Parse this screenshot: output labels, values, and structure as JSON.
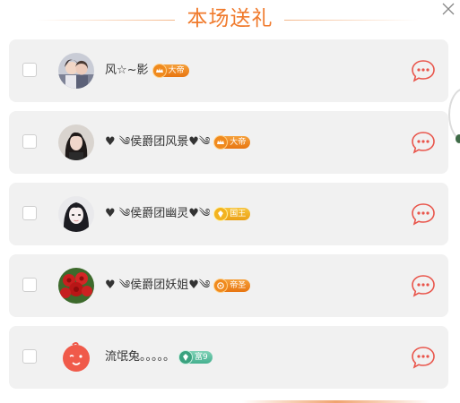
{
  "header": {
    "title": "本场送礼"
  },
  "colors": {
    "accent": "#f07a2c",
    "chat_icon": "#e9544a",
    "card_bg": "#f1f1f1"
  },
  "users": [
    {
      "name": "风☆~影",
      "badge": "大帝",
      "badge_style": "orange",
      "avatar": "couple-photo"
    },
    {
      "name": "♥ ༄侯爵团风景♥༄",
      "badge": "大帝",
      "badge_style": "orange",
      "avatar": "woman-dark-hair"
    },
    {
      "name": "♥ ༄侯爵团幽灵♥༄",
      "badge": "国王",
      "badge_style": "gold",
      "avatar": "woman-white-face"
    },
    {
      "name": "♥ ༄侯爵团妖姐♥༄",
      "badge": "帝圣",
      "badge_style": "orange",
      "avatar": "red-roses"
    },
    {
      "name": "流氓兔。。。。。",
      "badge": "富9",
      "badge_style": "green",
      "avatar": "red-cartoon-face"
    }
  ]
}
